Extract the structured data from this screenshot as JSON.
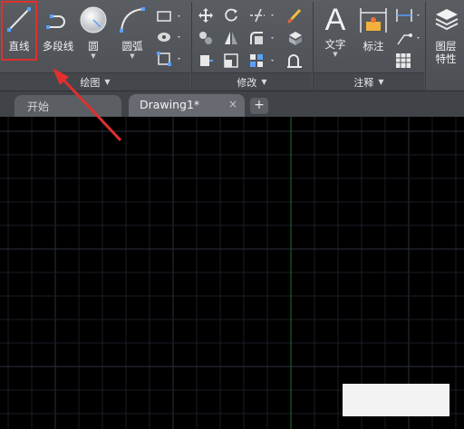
{
  "ribbon": {
    "draw_panel": {
      "line_label": "直线",
      "polyline_label": "多段线",
      "circle_label": "圆",
      "arc_label": "圆弧",
      "footer": "绘图"
    },
    "modify_panel": {
      "footer": "修改"
    },
    "annotate_panel": {
      "text_label": "文字",
      "dim_label": "标注",
      "footer": "注释"
    },
    "layers_panel": {
      "label_line1": "图层",
      "label_line2": "特性"
    }
  },
  "tabs": [
    {
      "label": "开始",
      "active": false
    },
    {
      "label": "Drawing1*",
      "active": true
    }
  ],
  "icons": {
    "tab_close": "×",
    "tab_add": "+",
    "dropdown": "▼"
  },
  "colors": {
    "highlight": "#e0302e",
    "canvas_bg": "#000000",
    "grid_minor": "#1a1d26",
    "grid_major": "#2a2f3c",
    "y_axis": "#1f6b2c"
  }
}
